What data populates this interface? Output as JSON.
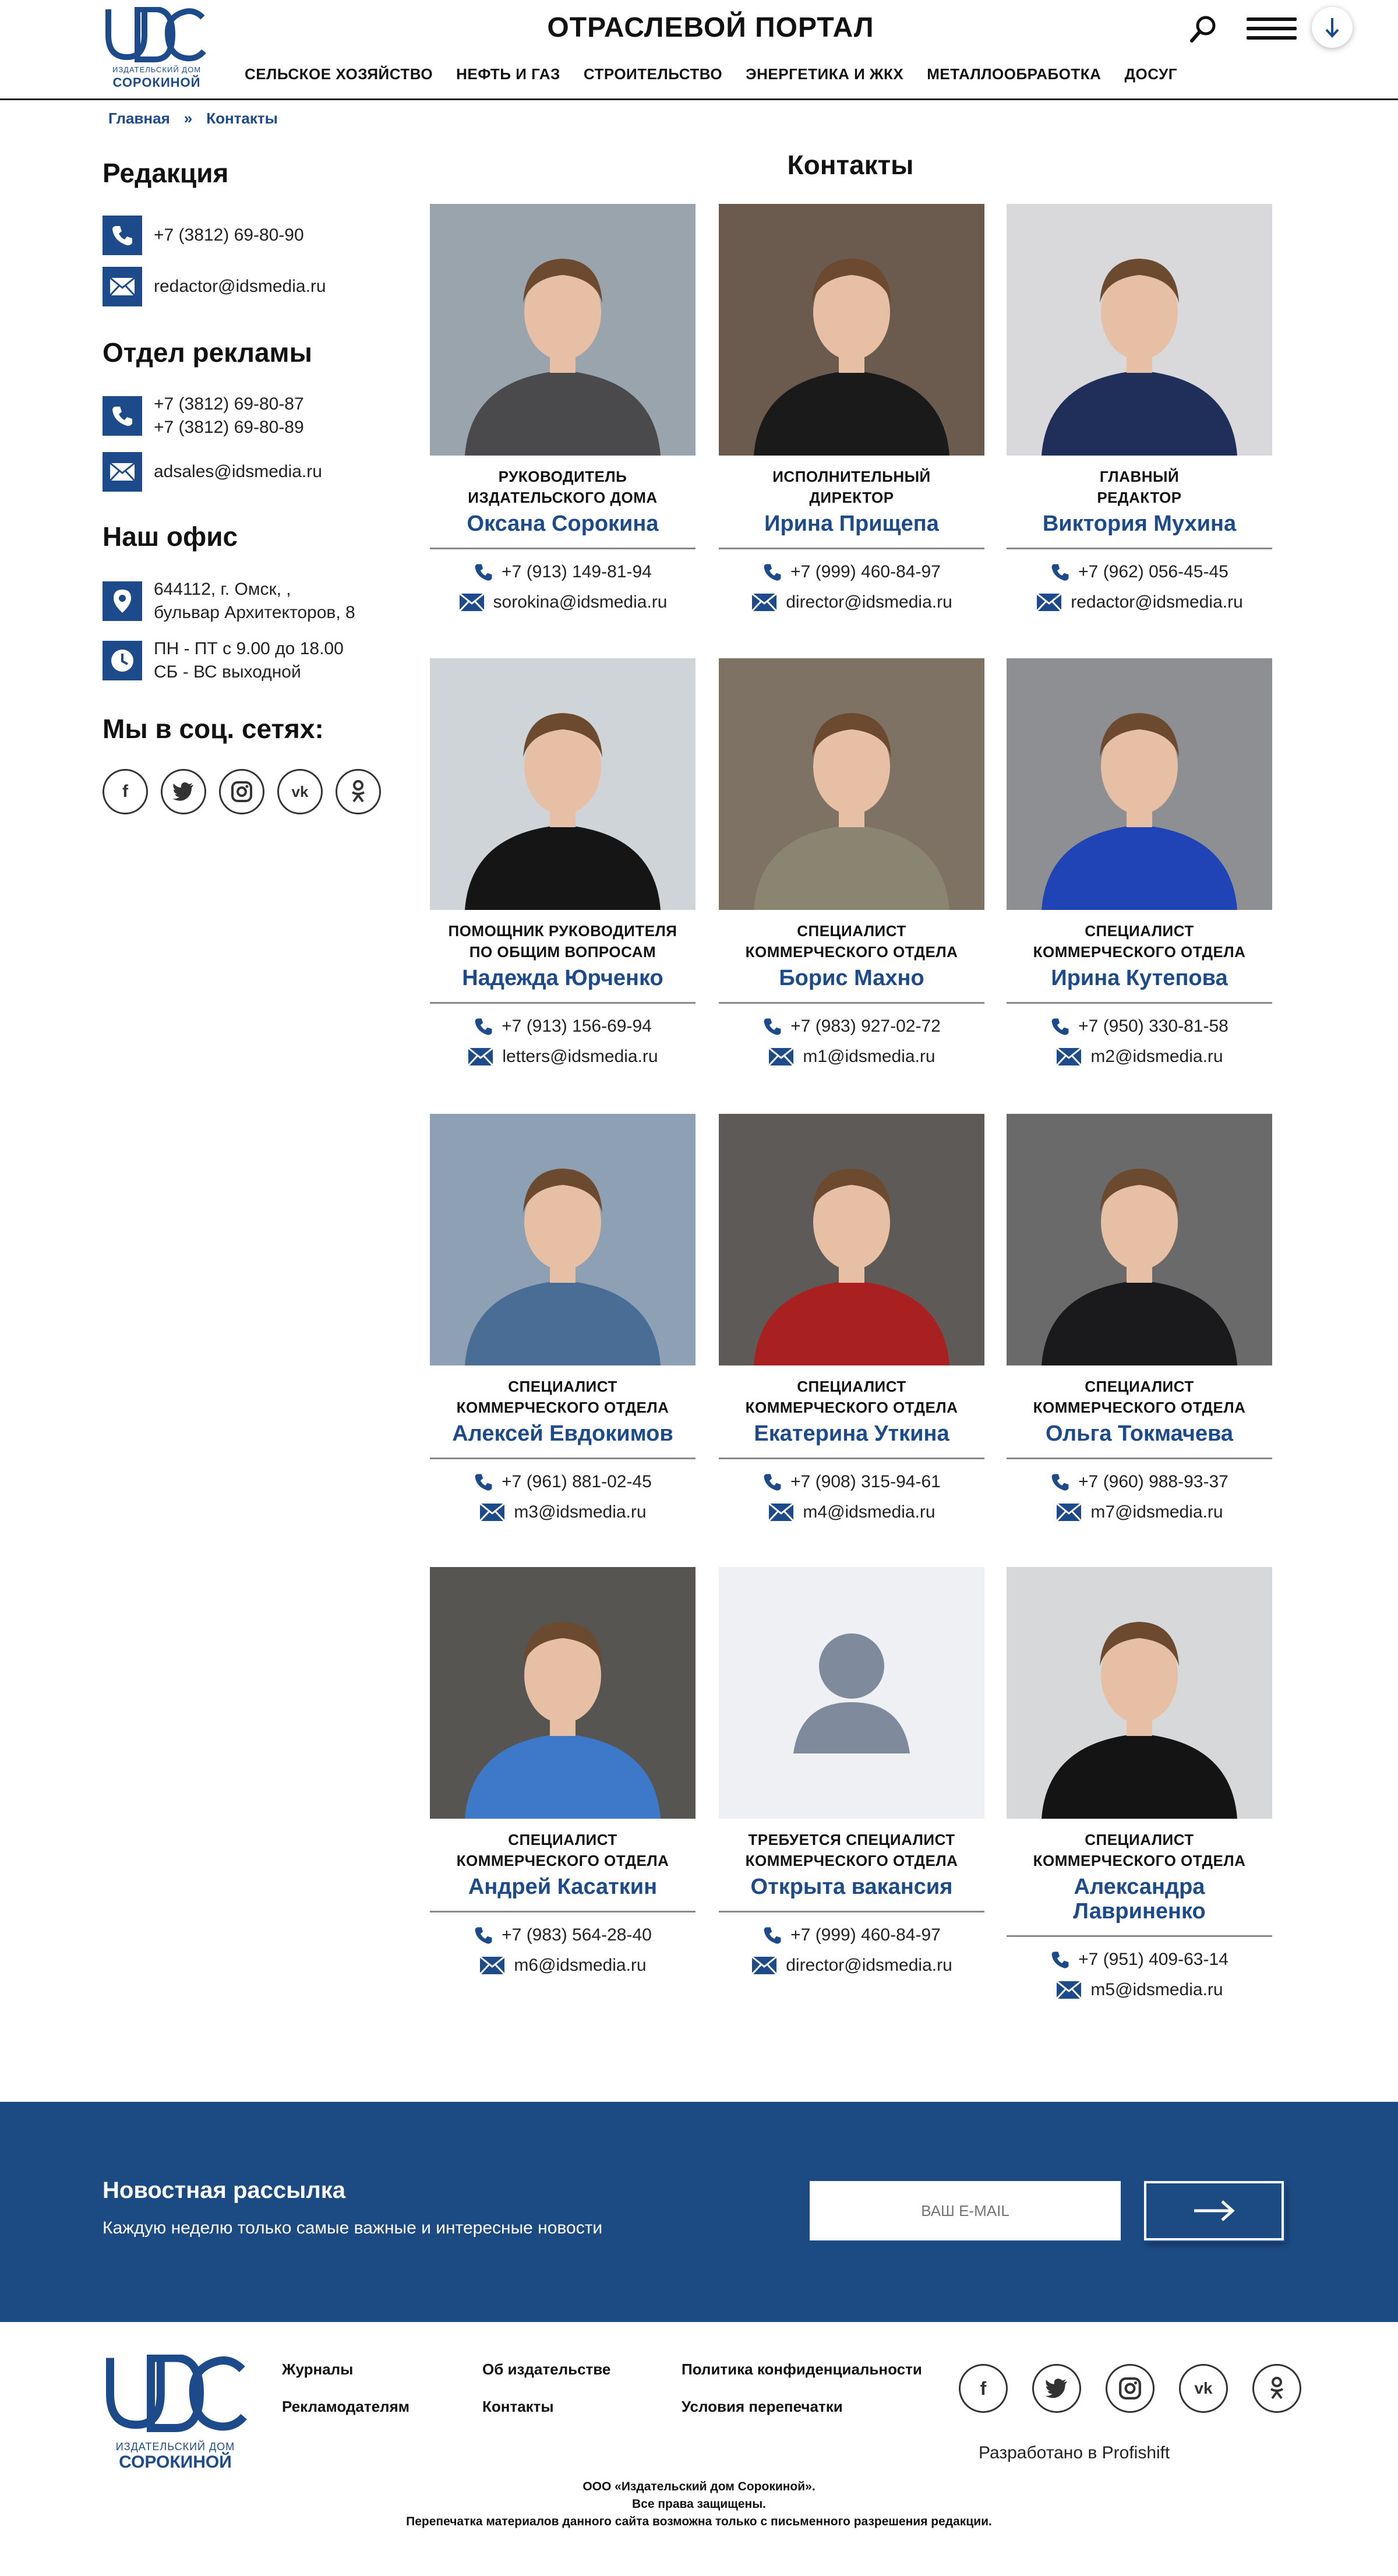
{
  "header": {
    "portal_title": "ОТРАСЛЕВОЙ ПОРТАЛ",
    "logo_letters": "UDC",
    "logo_sub1": "издательский дом",
    "logo_sub2": "СОРОКИНОЙ",
    "nav": [
      "СЕЛЬСКОЕ ХОЗЯЙСТВО",
      "НЕФТЬ И ГАЗ",
      "СТРОИТЕЛЬСТВО",
      "ЭНЕРГЕТИКА И ЖКХ",
      "МЕТАЛЛООБРАБОТКА",
      "ДОСУГ"
    ]
  },
  "breadcrumb": {
    "home": "Главная",
    "sep": "»",
    "current": "Контакты"
  },
  "sidebar": {
    "redaction": {
      "title": "Редакция",
      "phone": "+7 (3812) 69-80-90",
      "email": "redactor@idsmedia.ru"
    },
    "ads": {
      "title": "Отдел рекламы",
      "phone1": "+7 (3812) 69-80-87",
      "phone2": "+7 (3812) 69-80-89",
      "email": "adsales@idsmedia.ru"
    },
    "office": {
      "title": "Наш офис",
      "address1": "644112, г. Омск, ,",
      "address2": "бульвар Архитекторов, 8",
      "hours1": "ПН - ПТ с 9.00 до 18.00",
      "hours2": "СБ - ВС выходной"
    },
    "social": {
      "title": "Мы в соц. сетях:",
      "icons": [
        "facebook-icon",
        "twitter-icon",
        "instagram-icon",
        "vk-icon",
        "odnoklassniki-icon"
      ]
    }
  },
  "main": {
    "title": "Контакты",
    "contacts": [
      {
        "role1": "РУКОВОДИТЕЛЬ",
        "role2": "ИЗДАТЕЛЬСКОГО ДОМА",
        "name1": "Оксана Сорокина",
        "name2": "",
        "phone": "+7 (913) 149-81-94",
        "email": "sorokina@idsmedia.ru"
      },
      {
        "role1": "ИСПОЛНИТЕЛЬНЫЙ",
        "role2": "ДИРЕКТОР",
        "name1": "Ирина Прищепа",
        "name2": "",
        "phone": "+7 (999) 460-84-97",
        "email": "director@idsmedia.ru"
      },
      {
        "role1": "ГЛАВНЫЙ",
        "role2": "РЕДАКТОР",
        "name1": "Виктория Мухина",
        "name2": "",
        "phone": "+7 (962) 056-45-45",
        "email": "redactor@idsmedia.ru"
      },
      {
        "role1": "ПОМОЩНИК РУКОВОДИТЕЛЯ",
        "role2": "ПО ОБЩИМ ВОПРОСАМ",
        "name1": "Надежда Юрченко",
        "name2": "",
        "phone": "+7 (913) 156-69-94",
        "email": "letters@idsmedia.ru"
      },
      {
        "role1": "СПЕЦИАЛИСТ",
        "role2": "КОММЕРЧЕСКОГО ОТДЕЛА",
        "name1": "Борис Махно",
        "name2": "",
        "phone": "+7 (983) 927-02-72",
        "email": "m1@idsmedia.ru"
      },
      {
        "role1": "СПЕЦИАЛИСТ",
        "role2": "КОММЕРЧЕСКОГО ОТДЕЛА",
        "name1": "Ирина Кутепова",
        "name2": "",
        "phone": "+7 (950) 330-81-58",
        "email": "m2@idsmedia.ru"
      },
      {
        "role1": "СПЕЦИАЛИСТ",
        "role2": "КОММЕРЧЕСКОГО ОТДЕЛА",
        "name1": "Алексей Евдокимов",
        "name2": "",
        "phone": "+7 (961) 881-02-45",
        "email": "m3@idsmedia.ru"
      },
      {
        "role1": "СПЕЦИАЛИСТ",
        "role2": "КОММЕРЧЕСКОГО ОТДЕЛА",
        "name1": "Екатерина Уткина",
        "name2": "",
        "phone": "+7 (908) 315-94-61",
        "email": "m4@idsmedia.ru"
      },
      {
        "role1": "СПЕЦИАЛИСТ",
        "role2": "КОММЕРЧЕСКОГО ОТДЕЛА",
        "name1": "Ольга Токмачева",
        "name2": "",
        "phone": "+7 (960) 988-93-37",
        "email": "m7@idsmedia.ru"
      },
      {
        "role1": "СПЕЦИАЛИСТ",
        "role2": "КОММЕРЧЕСКОГО ОТДЕЛА",
        "name1": "Андрей Касаткин",
        "name2": "",
        "phone": "+7 (983) 564-28-40",
        "email": "m6@idsmedia.ru"
      },
      {
        "role1": "ТРЕБУЕТСЯ СПЕЦИАЛИСТ",
        "role2": "КОММЕРЧЕСКОГО ОТДЕЛА",
        "name1": "Открыта вакансия",
        "name2": "",
        "phone": "+7 (999) 460-84-97",
        "email": "director@idsmedia.ru"
      },
      {
        "role1": "СПЕЦИАЛИСТ",
        "role2": "КОММЕРЧЕСКОГО ОТДЕЛА",
        "name1": "Александра",
        "name2": "Лавриненко",
        "phone": "+7 (951) 409-63-14",
        "email": "m5@idsmedia.ru"
      }
    ]
  },
  "newsletter": {
    "title": "Новостная рассылка",
    "subtitle": "Каждую неделю только самые важные и интересные новости",
    "placeholder": "ВАШ E-MAIL"
  },
  "footer": {
    "col1": [
      "Журналы",
      "Рекламодателям"
    ],
    "col2": [
      "Об издательстве",
      "Контакты"
    ],
    "col3": [
      "Политика конфиденциальности",
      "Условия перепечатки"
    ],
    "developed": "Разработано в Profishift",
    "copy1": "ООО «Издательский дом Сорокиной».",
    "copy2": "Все права защищены.",
    "copy3": "Перепечатка материалов данного сайта возможна только с письменного разрешения редакции."
  },
  "colors": {
    "brand": "#1c4a8a",
    "newsletter_bg": "#1c4a82"
  }
}
